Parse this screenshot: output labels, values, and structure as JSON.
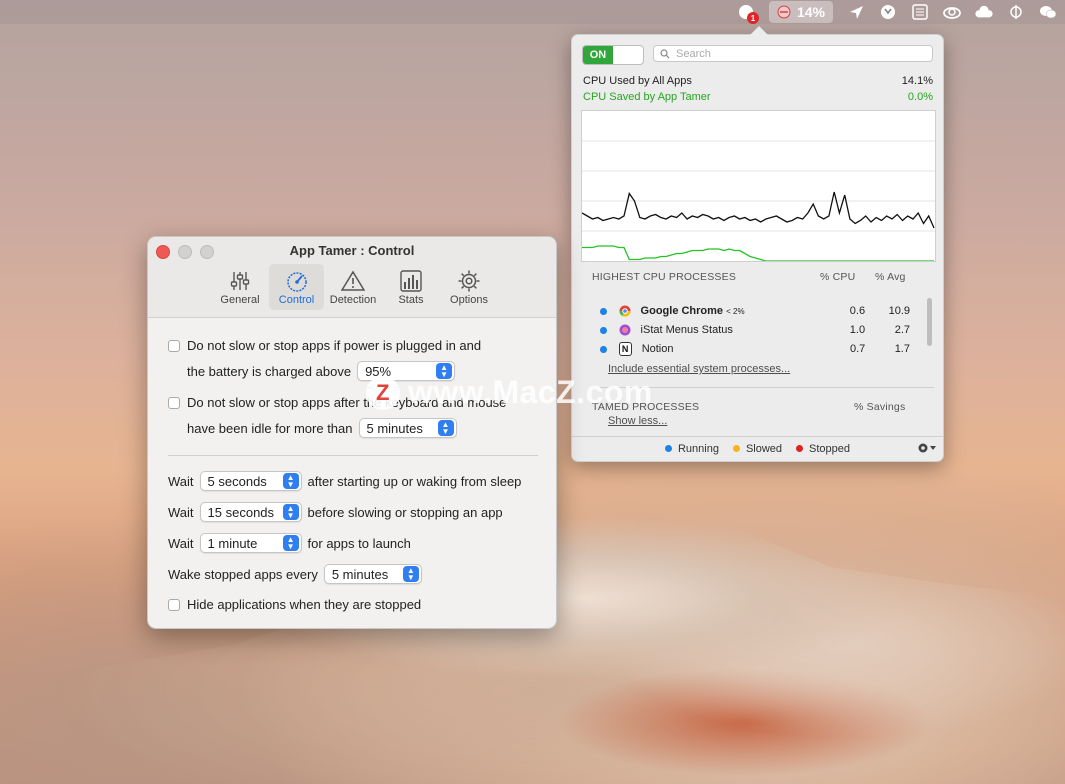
{
  "menubar": {
    "items": [
      {
        "icon": "notification-badge-icon",
        "badge": "1"
      },
      {
        "icon": "app-tamer-icon",
        "label": "14%",
        "active": true
      },
      {
        "icon": "location-arrow-icon"
      },
      {
        "icon": "shield-icon"
      },
      {
        "icon": "checklist-icon"
      },
      {
        "icon": "creative-cloud-icon"
      },
      {
        "icon": "cloud-sync-icon"
      },
      {
        "icon": "phi-icon"
      },
      {
        "icon": "wechat-icon"
      }
    ]
  },
  "popover": {
    "toggle": "ON",
    "search_placeholder": "Search",
    "cpu_used_label": "CPU Used by All Apps",
    "cpu_used_value": "14.1%",
    "cpu_saved_label": "CPU Saved by App Tamer",
    "cpu_saved_value": "0.0%",
    "graph": {
      "cpu_series": [
        0.32,
        0.3,
        0.28,
        0.29,
        0.27,
        0.28,
        0.29,
        0.28,
        0.3,
        0.45,
        0.4,
        0.29,
        0.28,
        0.3,
        0.31,
        0.29,
        0.28,
        0.3,
        0.29,
        0.32,
        0.28,
        0.3,
        0.29,
        0.31,
        0.3,
        0.28,
        0.29,
        0.27,
        0.29,
        0.3,
        0.28,
        0.29,
        0.27,
        0.28,
        0.26,
        0.28,
        0.29,
        0.3,
        0.28,
        0.26,
        0.27,
        0.29,
        0.28,
        0.32,
        0.38,
        0.3,
        0.28,
        0.3,
        0.46,
        0.32,
        0.44,
        0.28,
        0.25,
        0.27,
        0.3,
        0.26,
        0.29,
        0.27,
        0.3,
        0.28,
        0.31,
        0.27,
        0.3,
        0.28,
        0.32,
        0.25,
        0.3,
        0.22
      ],
      "saved_series": [
        0.09,
        0.09,
        0.09,
        0.1,
        0.1,
        0.1,
        0.1,
        0.09,
        0.09,
        0.01,
        0.01,
        0.01,
        0.02,
        0.02,
        0.02,
        0.03,
        0.03,
        0.04,
        0.05,
        0.05,
        0.06,
        0.07,
        0.07,
        0.07,
        0.08,
        0.08,
        0.08,
        0.07,
        0.08,
        0.07,
        0.07,
        0.05,
        0.03,
        0.02,
        0.01,
        0.0,
        0.0,
        0.0,
        0.0,
        0.0,
        0.0,
        0.0,
        0.0,
        0.0,
        0.0,
        0.0,
        0.0,
        0.0,
        0.0,
        0.0,
        0.0,
        0.0,
        0.0,
        0.0,
        0.0,
        0.0,
        0.0,
        0.0,
        0.0,
        0.0,
        0.0,
        0.0,
        0.0,
        0.0,
        0.0,
        0.0,
        0.0,
        0.0
      ]
    },
    "processes_header": {
      "title": "HIGHEST CPU PROCESSES",
      "cpu": "% CPU",
      "avg": "% Avg"
    },
    "processes": [
      {
        "name": "Google Chrome",
        "suffix": "< 2%",
        "cpu": "0.6",
        "avg": "10.9",
        "bold": true
      },
      {
        "name": "iStat Menus Status",
        "suffix": "",
        "cpu": "1.0",
        "avg": "2.7",
        "bold": false
      },
      {
        "name": "Notion",
        "suffix": "",
        "cpu": "0.7",
        "avg": "1.7",
        "bold": false
      }
    ],
    "include_link": "Include essential system processes...",
    "tamed_header": {
      "title": "TAMED PROCESSES",
      "savings": "% Savings"
    },
    "show_less": "Show less...",
    "legend": {
      "running": "Running",
      "slowed": "Slowed",
      "stopped": "Stopped"
    },
    "colors": {
      "running": "#1e83e6",
      "slowed": "#f5b51b",
      "stopped": "#e02020",
      "saved": "#22c322"
    }
  },
  "window": {
    "title": "App Tamer : Control",
    "tabs": [
      {
        "label": "General",
        "icon": "sliders-icon"
      },
      {
        "label": "Control",
        "icon": "gauge-icon",
        "active": true
      },
      {
        "label": "Detection",
        "icon": "warning-icon"
      },
      {
        "label": "Stats",
        "icon": "chart-icon"
      },
      {
        "label": "Options",
        "icon": "gear-icon"
      }
    ],
    "power_line1": "Do not slow or stop apps if power is plugged in and",
    "power_line2": "the battery is charged above",
    "battery_value": "95%",
    "idle_line1": "Do not slow or stop apps after the keyboard and mouse",
    "idle_line2": "have been idle for more than",
    "idle_value": "5 minutes",
    "wait_label": "Wait",
    "wait1_value": "5 seconds",
    "wait1_text": "after starting up or waking from sleep",
    "wait2_value": "15 seconds",
    "wait2_text": "before slowing or stopping an app",
    "wait3_value": "1 minute",
    "wait3_text": "for apps to launch",
    "wake_label": "Wake stopped apps every",
    "wake_value": "5 minutes",
    "hide_label": "Hide applications when they are stopped"
  },
  "watermark": {
    "logo": "Z",
    "text": "www.MacZ.com"
  }
}
